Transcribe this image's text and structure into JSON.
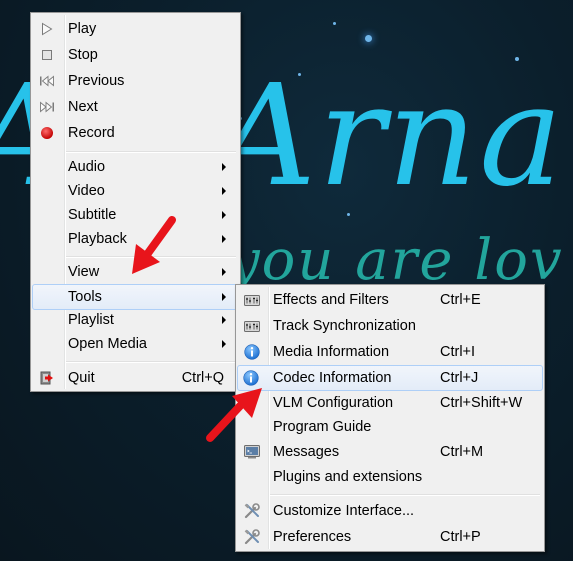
{
  "background": {
    "title_text": "Arna",
    "title_prefix": "A",
    "subtitle_text": "you are lov",
    "title_color": "#27c2ea",
    "subtitle_color": "#22a59c"
  },
  "main_menu": {
    "items": [
      {
        "label": "Play",
        "icon": "play-icon",
        "shortcut": "",
        "submenu": false
      },
      {
        "label": "Stop",
        "icon": "stop-icon",
        "shortcut": "",
        "submenu": false
      },
      {
        "label": "Previous",
        "icon": "previous-icon",
        "shortcut": "",
        "submenu": false
      },
      {
        "label": "Next",
        "icon": "next-icon",
        "shortcut": "",
        "submenu": false
      },
      {
        "label": "Record",
        "icon": "record-icon",
        "shortcut": "",
        "submenu": false
      },
      {
        "label": "Audio",
        "icon": "",
        "shortcut": "",
        "submenu": true
      },
      {
        "label": "Video",
        "icon": "",
        "shortcut": "",
        "submenu": true
      },
      {
        "label": "Subtitle",
        "icon": "",
        "shortcut": "",
        "submenu": true
      },
      {
        "label": "Playback",
        "icon": "",
        "shortcut": "",
        "submenu": true
      },
      {
        "label": "View",
        "icon": "",
        "shortcut": "",
        "submenu": true
      },
      {
        "label": "Tools",
        "icon": "",
        "shortcut": "",
        "submenu": true,
        "highlighted": true
      },
      {
        "label": "Playlist",
        "icon": "",
        "shortcut": "",
        "submenu": true
      },
      {
        "label": "Open Media",
        "icon": "",
        "shortcut": "",
        "submenu": true
      },
      {
        "label": "Quit",
        "icon": "quit-icon",
        "shortcut": "Ctrl+Q",
        "submenu": false
      }
    ]
  },
  "tools_submenu": {
    "items": [
      {
        "label": "Effects and Filters",
        "icon": "equalizer-icon",
        "shortcut": "Ctrl+E"
      },
      {
        "label": "Track Synchronization",
        "icon": "equalizer-icon",
        "shortcut": ""
      },
      {
        "label": "Media Information",
        "icon": "info-icon",
        "shortcut": "Ctrl+I"
      },
      {
        "label": "Codec Information",
        "icon": "info-icon",
        "shortcut": "Ctrl+J",
        "highlighted": true
      },
      {
        "label": "VLM Configuration",
        "icon": "",
        "shortcut": "Ctrl+Shift+W"
      },
      {
        "label": "Program Guide",
        "icon": "",
        "shortcut": ""
      },
      {
        "label": "Messages",
        "icon": "terminal-icon",
        "shortcut": "Ctrl+M"
      },
      {
        "label": "Plugins and extensions",
        "icon": "",
        "shortcut": ""
      },
      {
        "label": "Customize Interface...",
        "icon": "tools-icon",
        "shortcut": ""
      },
      {
        "label": "Preferences",
        "icon": "tools-icon",
        "shortcut": "Ctrl+P"
      }
    ]
  },
  "annotations": {
    "arrow_color": "#e8141b"
  }
}
